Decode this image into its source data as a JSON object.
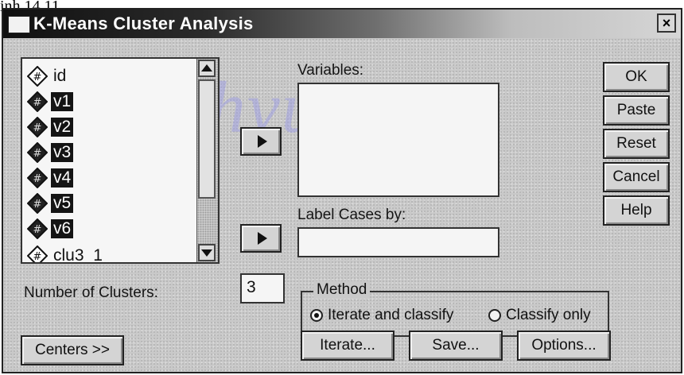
{
  "page_caption": "inh 14.11",
  "window": {
    "title": "K-Means Cluster Analysis",
    "close_glyph": "×"
  },
  "variable_list": {
    "items": [
      {
        "label": "id",
        "selected": false
      },
      {
        "label": "v1",
        "selected": true
      },
      {
        "label": "v2",
        "selected": true
      },
      {
        "label": "v3",
        "selected": true
      },
      {
        "label": "v4",
        "selected": true
      },
      {
        "label": "v5",
        "selected": true
      },
      {
        "label": "v6",
        "selected": true
      },
      {
        "label": "clu3_1",
        "selected": false
      }
    ]
  },
  "variables_field": {
    "label": "Variables:"
  },
  "label_cases_field": {
    "label": "Label Cases by:"
  },
  "buttons": {
    "ok": "OK",
    "paste": "Paste",
    "reset": "Reset",
    "cancel": "Cancel",
    "help": "Help",
    "centers": "Centers >>",
    "iterate": "Iterate...",
    "save": "Save...",
    "options": "Options..."
  },
  "clusters": {
    "label": "Number of Clusters:",
    "value": "3"
  },
  "method": {
    "legend": "Method",
    "options": [
      {
        "label": "Iterate and classify",
        "checked": true
      },
      {
        "label": "Classify only",
        "checked": false
      }
    ]
  },
  "watermark": "Sachvui.Com"
}
